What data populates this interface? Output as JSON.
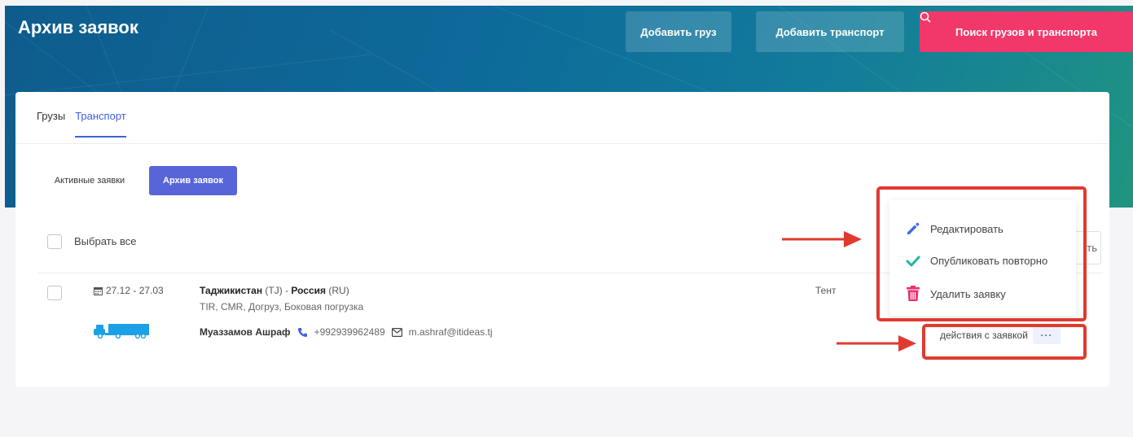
{
  "header": {
    "title": "Архив заявок",
    "add_cargo": "Добавить груз",
    "add_transport": "Добавить транспорт",
    "search": "Поиск грузов и транспорта"
  },
  "tabs": [
    {
      "label": "Грузы",
      "active": false
    },
    {
      "label": "Транспорт",
      "active": true
    }
  ],
  "filters": {
    "active": "Активные заявки",
    "archive": "Архив заявок"
  },
  "select_all": "Выбрать все",
  "partial_button": "ть",
  "row": {
    "date": "27.12 - 27.03",
    "from": "Таджикистан",
    "from_code": "(TJ)",
    "separator": "-",
    "to": "Россия",
    "to_code": "(RU)",
    "properties": "TIR, CMR, Догруз, Боковая погрузка",
    "contact_name": "Муаззамов Ашраф",
    "phone": "+992939962489",
    "email": "m.ashraf@itideas.tj",
    "body_type": "Тент",
    "actions_label": "действия с заявкой",
    "actions_dots": "···"
  },
  "menu": {
    "edit": "Редактировать",
    "republish": "Опубликовать повторно",
    "delete": "Удалить заявку"
  },
  "colors": {
    "accent": "#5865d9",
    "search_button": "#f2386a",
    "annotation": "#e03a2e",
    "truck": "#1da1e6"
  }
}
